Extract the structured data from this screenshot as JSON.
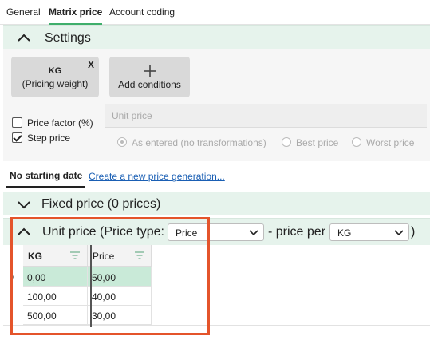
{
  "tabs": [
    {
      "label": "General",
      "active": false
    },
    {
      "label": "Matrix price",
      "active": true
    },
    {
      "label": "Account coding",
      "active": false
    }
  ],
  "settings": {
    "title": "Settings",
    "kg_tile": {
      "line1": "KG",
      "line2": "(Pricing weight)",
      "close": "X"
    },
    "add_conditions": "Add conditions",
    "unit_price_label": "Unit price",
    "price_factor": {
      "label": "Price factor (%)",
      "checked": false
    },
    "step_price": {
      "label": "Step price",
      "checked": true
    },
    "radios": [
      {
        "label": "As entered (no transformations)",
        "selected": true
      },
      {
        "label": "Best price",
        "selected": false
      },
      {
        "label": "Worst price",
        "selected": false
      }
    ]
  },
  "generation": {
    "active_tab": "No starting date",
    "link": "Create a new price generation..."
  },
  "fixed_price": {
    "title": "Fixed price (0 prices)"
  },
  "unit_price": {
    "prefix": "Unit price (Price type:",
    "price_type": "Price",
    "middle": "- price per",
    "unit": "KG",
    "suffix": ")"
  },
  "grid": {
    "columns": [
      "KG",
      "Price"
    ],
    "rows": [
      [
        "0,00",
        "50,00"
      ],
      [
        "100,00",
        "40,00"
      ],
      [
        "500,00",
        "30,00"
      ]
    ]
  },
  "colors": {
    "accent": "#3fae6b",
    "header_bg": "#e6f3ec",
    "highlight": "#e4542b",
    "selected_row": "#c9ead8",
    "link": "#1a5fb4"
  }
}
